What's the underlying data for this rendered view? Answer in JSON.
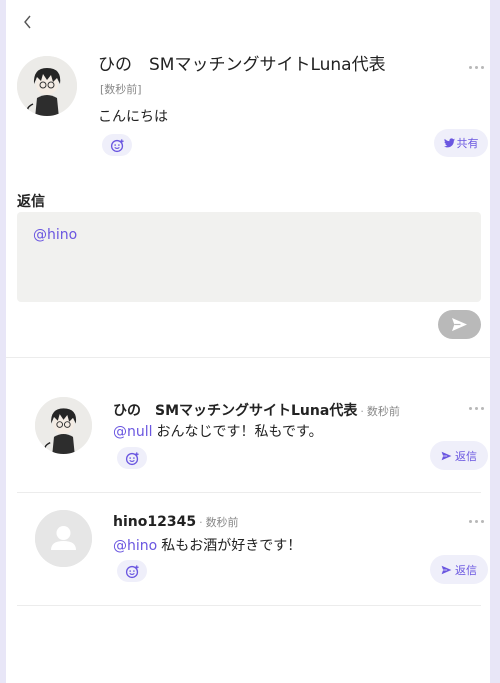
{
  "post": {
    "author": "ひの　SMマッチングサイトLuna代表",
    "time": "[数秒前]",
    "body": "こんにちは",
    "share_label": "共有"
  },
  "reply": {
    "heading": "返信",
    "input_value": "@hino"
  },
  "comments": [
    {
      "author": "ひの　SMマッチングサイトLuna代表",
      "dot": "·",
      "time": "数秒前",
      "mention": "@null",
      "text": "おんなじです！私もです。",
      "reply_label": "返信"
    },
    {
      "author": "hino12345",
      "dot": "·",
      "time": "数秒前",
      "mention": "@hino",
      "text": "私もお酒が好きです！",
      "reply_label": "返信"
    }
  ],
  "colors": {
    "accent": "#6a56e0",
    "accent_bg": "#efeffa",
    "page_bg": "#e8e6f7",
    "send_disabled": "#b9b9b9"
  },
  "icons": [
    "back-icon",
    "more-icon",
    "emoji-add-icon",
    "twitter-icon",
    "send-icon",
    "user-placeholder-icon"
  ]
}
